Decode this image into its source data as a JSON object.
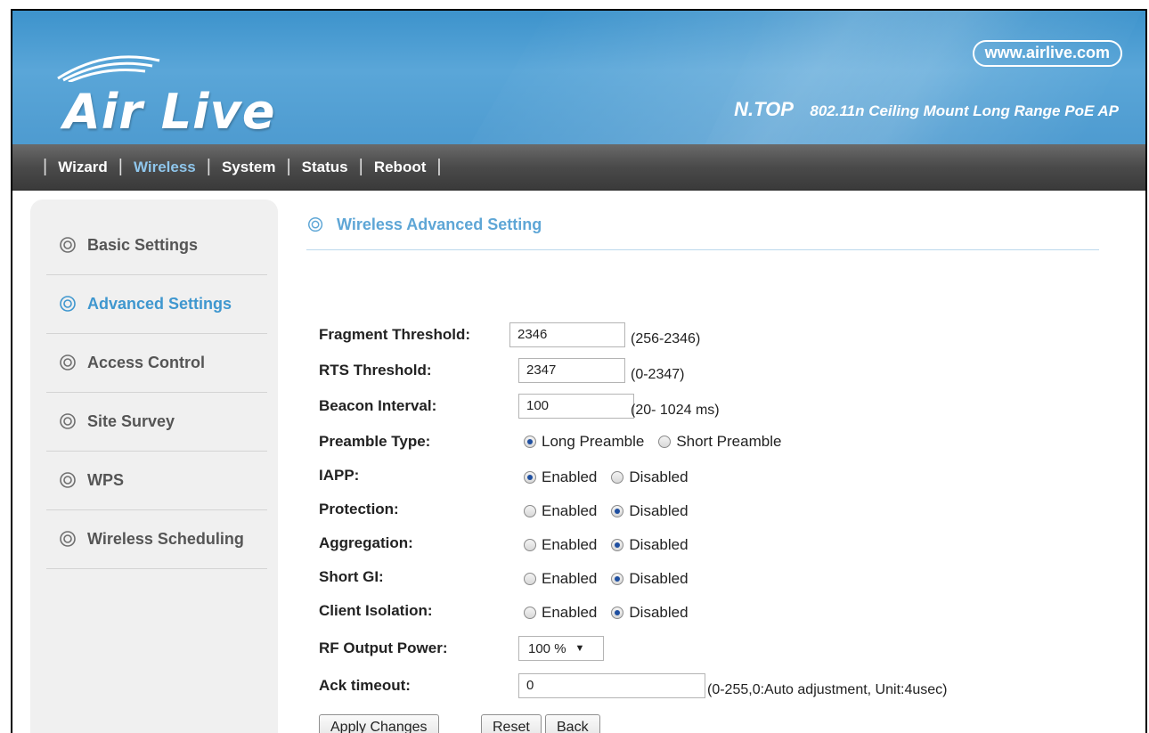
{
  "brand": {
    "logo_text": "Air Live",
    "website": "www.airlive.com",
    "model": "N.TOP",
    "description": "802.11n Ceiling Mount Long Range PoE AP"
  },
  "topnav": {
    "items": [
      {
        "label": "Wizard"
      },
      {
        "label": "Wireless",
        "active": true
      },
      {
        "label": "System"
      },
      {
        "label": "Status"
      },
      {
        "label": "Reboot"
      }
    ]
  },
  "sidebar": {
    "items": [
      {
        "label": "Basic Settings"
      },
      {
        "label": "Advanced Settings",
        "active": true
      },
      {
        "label": "Access Control"
      },
      {
        "label": "Site Survey"
      },
      {
        "label": "WPS"
      },
      {
        "label": "Wireless Scheduling"
      }
    ]
  },
  "page": {
    "title": "Wireless Advanced Setting"
  },
  "form": {
    "fragment_threshold": {
      "label": "Fragment Threshold:",
      "value": "2346",
      "hint": "(256-2346)"
    },
    "rts_threshold": {
      "label": "RTS Threshold:",
      "value": "2347",
      "hint": "(0-2347)"
    },
    "beacon_interval": {
      "label": "Beacon Interval:",
      "value": "100",
      "hint": "(20- 1024 ms)"
    },
    "preamble_type": {
      "label": "Preamble Type:",
      "options": [
        "Long Preamble",
        "Short Preamble"
      ],
      "selected": "Long Preamble"
    },
    "iapp": {
      "label": "IAPP:",
      "options": [
        "Enabled",
        "Disabled"
      ],
      "selected": "Enabled"
    },
    "protection": {
      "label": "Protection:",
      "options": [
        "Enabled",
        "Disabled"
      ],
      "selected": "Disabled"
    },
    "aggregation": {
      "label": "Aggregation:",
      "options": [
        "Enabled",
        "Disabled"
      ],
      "selected": "Disabled"
    },
    "short_gi": {
      "label": "Short GI:",
      "options": [
        "Enabled",
        "Disabled"
      ],
      "selected": "Disabled"
    },
    "client_isolation": {
      "label": "Client Isolation:",
      "options": [
        "Enabled",
        "Disabled"
      ],
      "selected": "Disabled"
    },
    "rf_output_power": {
      "label": "RF Output Power:",
      "value": "100 %"
    },
    "ack_timeout": {
      "label": "Ack timeout:",
      "value": "0",
      "hint": "(0-255,0:Auto adjustment, Unit:4usec)"
    }
  },
  "buttons": {
    "apply": "Apply Changes",
    "reset": "Reset",
    "back": "Back"
  },
  "colors": {
    "banner_blue": "#4e9bd0",
    "active_link": "#3f97cf",
    "nav_dark": "#4a4a4a"
  }
}
